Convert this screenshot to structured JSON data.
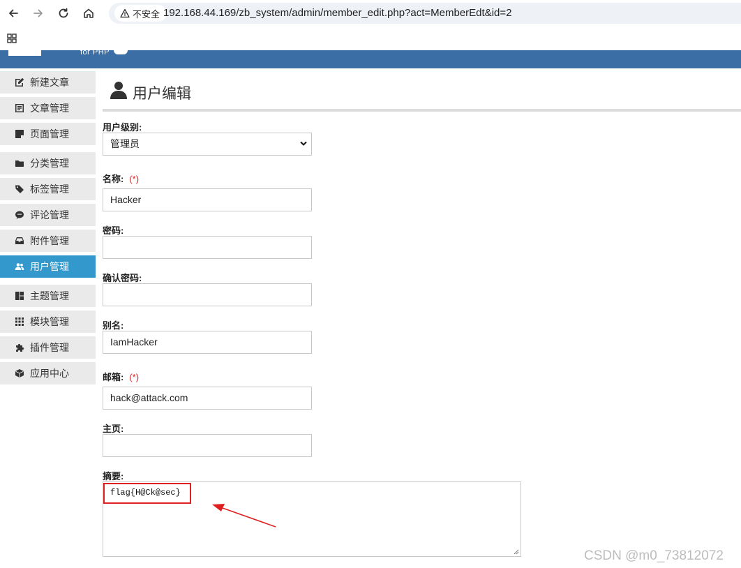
{
  "browser": {
    "security_label": "不安全",
    "url": "192.168.44.169/zb_system/admin/member_edit.php?act=MemberEdt&id=2"
  },
  "header": {
    "logo_sub": "for PHP"
  },
  "sidebar": {
    "items": [
      {
        "label": "新建文章",
        "icon": "edit-icon"
      },
      {
        "label": "文章管理",
        "icon": "article-list-icon"
      },
      {
        "label": "页面管理",
        "icon": "page-icon"
      },
      {
        "label": "分类管理",
        "icon": "folder-icon"
      },
      {
        "label": "标签管理",
        "icon": "tag-icon"
      },
      {
        "label": "评论管理",
        "icon": "comment-icon"
      },
      {
        "label": "附件管理",
        "icon": "inbox-icon"
      },
      {
        "label": "用户管理",
        "icon": "users-icon",
        "active": true
      },
      {
        "label": "主题管理",
        "icon": "theme-icon"
      },
      {
        "label": "模块管理",
        "icon": "grid-icon"
      },
      {
        "label": "插件管理",
        "icon": "puzzle-icon"
      },
      {
        "label": "应用中心",
        "icon": "box-icon"
      }
    ]
  },
  "page": {
    "title": "用户编辑"
  },
  "form": {
    "level": {
      "label": "用户级别:",
      "value": "管理员"
    },
    "name": {
      "label": "名称:",
      "required": "(*)",
      "value": "Hacker"
    },
    "password": {
      "label": "密码:",
      "value": ""
    },
    "confirm_password": {
      "label": "确认密码:",
      "value": ""
    },
    "alias": {
      "label": "别名:",
      "value": "IamHacker"
    },
    "email": {
      "label": "邮箱:",
      "required": "(*)",
      "value": "hack@attack.com"
    },
    "homepage": {
      "label": "主页:",
      "value": ""
    },
    "summary": {
      "label": "摘要:",
      "value": "flag{H@Ck@sec}"
    }
  },
  "watermark": "CSDN @m0_73812072",
  "colors": {
    "header": "#3a6ea5",
    "active": "#3399cc",
    "required": "#e02020",
    "highlight": "#e02020"
  }
}
